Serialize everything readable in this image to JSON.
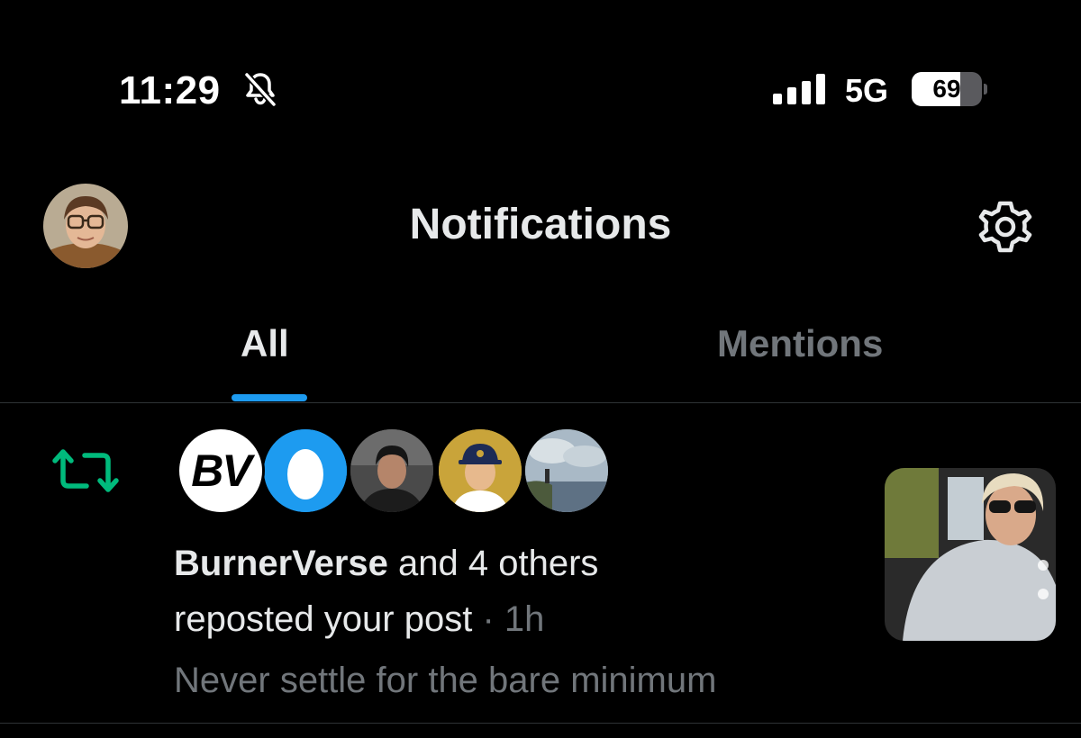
{
  "status_bar": {
    "time": "11:29",
    "network": "5G",
    "battery": "69",
    "battery_level": 0.69,
    "icons": [
      "bell-slash-icon",
      "signal-bars-icon",
      "battery-icon"
    ]
  },
  "header": {
    "title": "Notifications",
    "icons": [
      "profile-avatar",
      "gear-icon"
    ]
  },
  "tabs": [
    {
      "label": "All",
      "selected": true
    },
    {
      "label": "Mentions",
      "selected": false
    }
  ],
  "notification": {
    "type_icon": "repost-icon",
    "avatars": [
      "BV",
      "egg",
      "person",
      "cartoon-person",
      "landscape"
    ],
    "actor": "BurnerVerse",
    "others": "and 4 others",
    "action": "reposted your post",
    "separator": "·",
    "time": "1h",
    "post_text": "Never settle for the bare minimum"
  },
  "colors": {
    "background": "#000000",
    "accent": "#1d9bf0",
    "repost": "#00ba7c",
    "muted": "#71767b"
  }
}
